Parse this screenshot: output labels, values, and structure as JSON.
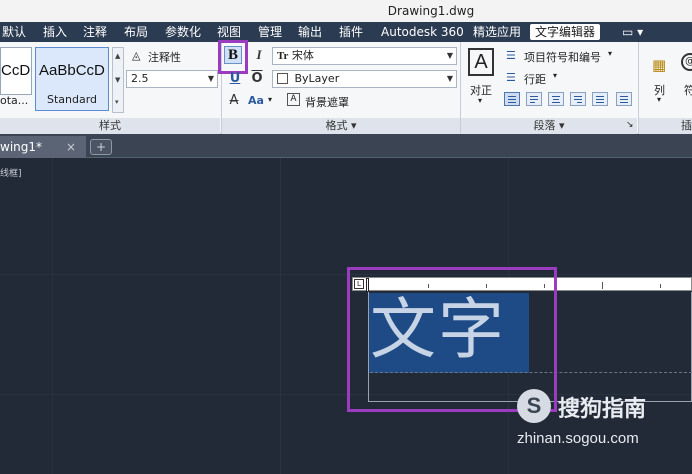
{
  "window": {
    "title": "Drawing1.dwg"
  },
  "menu": {
    "items": [
      "默认",
      "插入",
      "注释",
      "布局",
      "参数化",
      "视图",
      "管理",
      "输出",
      "插件",
      "Autodesk 360",
      "精选应用"
    ],
    "active": "文字编辑器",
    "extra_icon": "▭ ▾"
  },
  "ribbon": {
    "styles_panel": {
      "label": "样式",
      "style_partial_sample": "CcD",
      "style_partial_name": "ota...",
      "style_sample": "AaBbCcD",
      "style_name": "Standard",
      "annotative_label": "注释性",
      "text_height": "2.5"
    },
    "format_panel": {
      "label": "格式 ▾",
      "bold": "B",
      "italic": "I",
      "underline": "U",
      "overline": "O",
      "strike": "A",
      "case": "Aa",
      "font": "宋体",
      "font_prefix": "Tr",
      "color": "ByLayer",
      "background_mask": "背景遮罩"
    },
    "paragraph_panel": {
      "label": "段落 ▾",
      "justify": "对正",
      "bullets": "项目符号和编号",
      "line_spacing": "行距",
      "corner": "↘"
    },
    "columns_panel": {
      "columns": "列",
      "symbol": "符",
      "insert_partial": "插"
    }
  },
  "doc_tabs": {
    "active": "wing1*",
    "close": "×",
    "new": "+"
  },
  "canvas": {
    "viewport_label": "线框]",
    "edited_text": "文字"
  },
  "watermark": {
    "brand": "搜狗指南",
    "url": "zhinan.sogou.com",
    "logo": "S"
  }
}
